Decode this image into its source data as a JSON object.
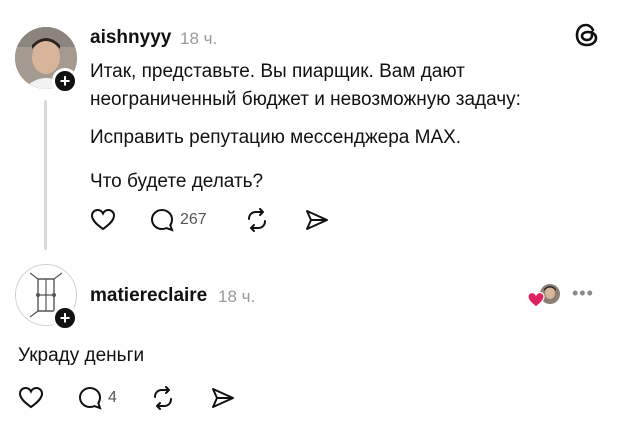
{
  "post1": {
    "username": "aishnyyy",
    "time": "18 ч.",
    "lines": [
      "Итак, представьте. Вы пиарщик. Вам дают",
      "неограниченный бюджет и невозможную задачу:",
      "Исправить репутацию мессенджера MAX.",
      "Что будете делать?"
    ],
    "reply_count": "267"
  },
  "post2": {
    "username": "matiereclaire",
    "time": "18 ч.",
    "text": "Украду деньги",
    "reply_count": "4"
  },
  "icons": {
    "plus": "+",
    "more": "•••",
    "logo": "threads-logo-icon"
  },
  "colors": {
    "text": "#111111",
    "muted": "#9a9a9a",
    "like_heart": "#e0245e"
  }
}
